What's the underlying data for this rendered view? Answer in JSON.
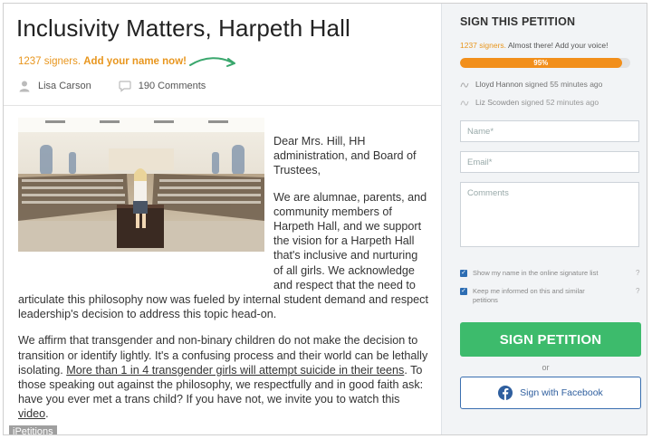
{
  "petition": {
    "title": "Inclusivity Matters, Harpeth Hall",
    "signers_count": "1237 signers.",
    "signers_cta": "Add your name now!",
    "author": "Lisa Carson",
    "comments": "190 Comments"
  },
  "body": {
    "p1": "Dear Mrs. Hill, HH administration, and Board of Trustees,",
    "p2": "We are alumnae, parents, and community members of Harpeth Hall, and we support the vision for a Harpeth Hall that's inclusive and nurturing of all girls. We acknowledge and respect that the need to articulate this philosophy now was fueled by internal student demand and respect leadership's decision to address this topic head-on.",
    "p3_start": "We affirm that transgender and non-binary children do not make the decision to transition or identify lightly. It's a confusing process and their world can be lethally isolating. ",
    "p3_link": "More than 1 in 4 transgender girls will attempt suicide in their teens",
    "p3_mid": ". To those speaking out against the philosophy, we respectfully and in good faith ask: have you ever met a trans child? If you have not, we invite you to watch this ",
    "p3_link2": "video",
    "p3_end": "."
  },
  "watermark": "iPetitions",
  "sidebar": {
    "title": "SIGN THIS PETITION",
    "signers_count": "1237 signers.",
    "signers_text": "Almost there! Add your voice!",
    "progress_label": "95%",
    "progress": 0.95,
    "recent": [
      {
        "name": "Lloyd Hannon",
        "action": "signed 55 minutes ago"
      },
      {
        "name": "Liz Scowden",
        "action": "signed 52 minutes ago"
      }
    ],
    "name_placeholder": "Name*",
    "email_placeholder": "Email*",
    "comments_placeholder": "Comments",
    "check1": "Show my name in the online signature list",
    "check2": "Keep me informed on this and similar petitions",
    "sign_button": "SIGN PETITION",
    "or": "or",
    "facebook_button": "Sign with Facebook"
  },
  "colors": {
    "accent_orange": "#f28f1b",
    "sign_green": "#3dbb6c",
    "facebook_blue": "#2f5f9f",
    "arrow_green": "#3aa76d"
  }
}
